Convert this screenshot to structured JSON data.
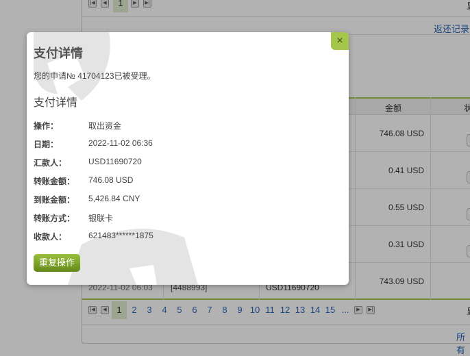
{
  "background": {
    "top_pagination": {
      "current": "1"
    },
    "return_link": "返还记录",
    "show_label": "显",
    "table": {
      "headers": {
        "amount": "金额",
        "status": "状"
      },
      "rows": [
        {
          "amount": "746.08 USD"
        },
        {
          "amount": "0.41 USD"
        },
        {
          "amount": "0.55 USD"
        },
        {
          "amount": "0.31 USD"
        },
        {
          "date": "2022-11-02 06:03",
          "id": "[4488993]",
          "account": "USD11690720",
          "amount": "743.09 USD"
        }
      ]
    },
    "pagination": {
      "pages": [
        "1",
        "2",
        "3",
        "4",
        "5",
        "6",
        "7",
        "8",
        "9",
        "10",
        "11",
        "12",
        "13",
        "14",
        "15"
      ],
      "ellipsis": "...",
      "current": "1"
    },
    "all_link": "所有"
  },
  "modal": {
    "title": "支付详情",
    "close_icon": "×",
    "message": "您的申请№ 41704123已被受理。",
    "section_title": "支付详情",
    "fields": [
      {
        "label": "操作：",
        "value": "取出资金"
      },
      {
        "label": "日期：",
        "value": "2022-11-02 06:36"
      },
      {
        "label": "汇款人：",
        "value": "USD11690720"
      },
      {
        "label": "转账金额：",
        "value": "746.08 USD"
      },
      {
        "label": "到账金额：",
        "value": "5,426.84 CNY"
      },
      {
        "label": "转账方式：",
        "value": "银联卡"
      },
      {
        "label": "收款人：",
        "value": "621483******1875"
      }
    ],
    "repeat_button": "重复操作"
  },
  "colors": {
    "accent": "#a4c64a",
    "link": "#2a66b8"
  }
}
